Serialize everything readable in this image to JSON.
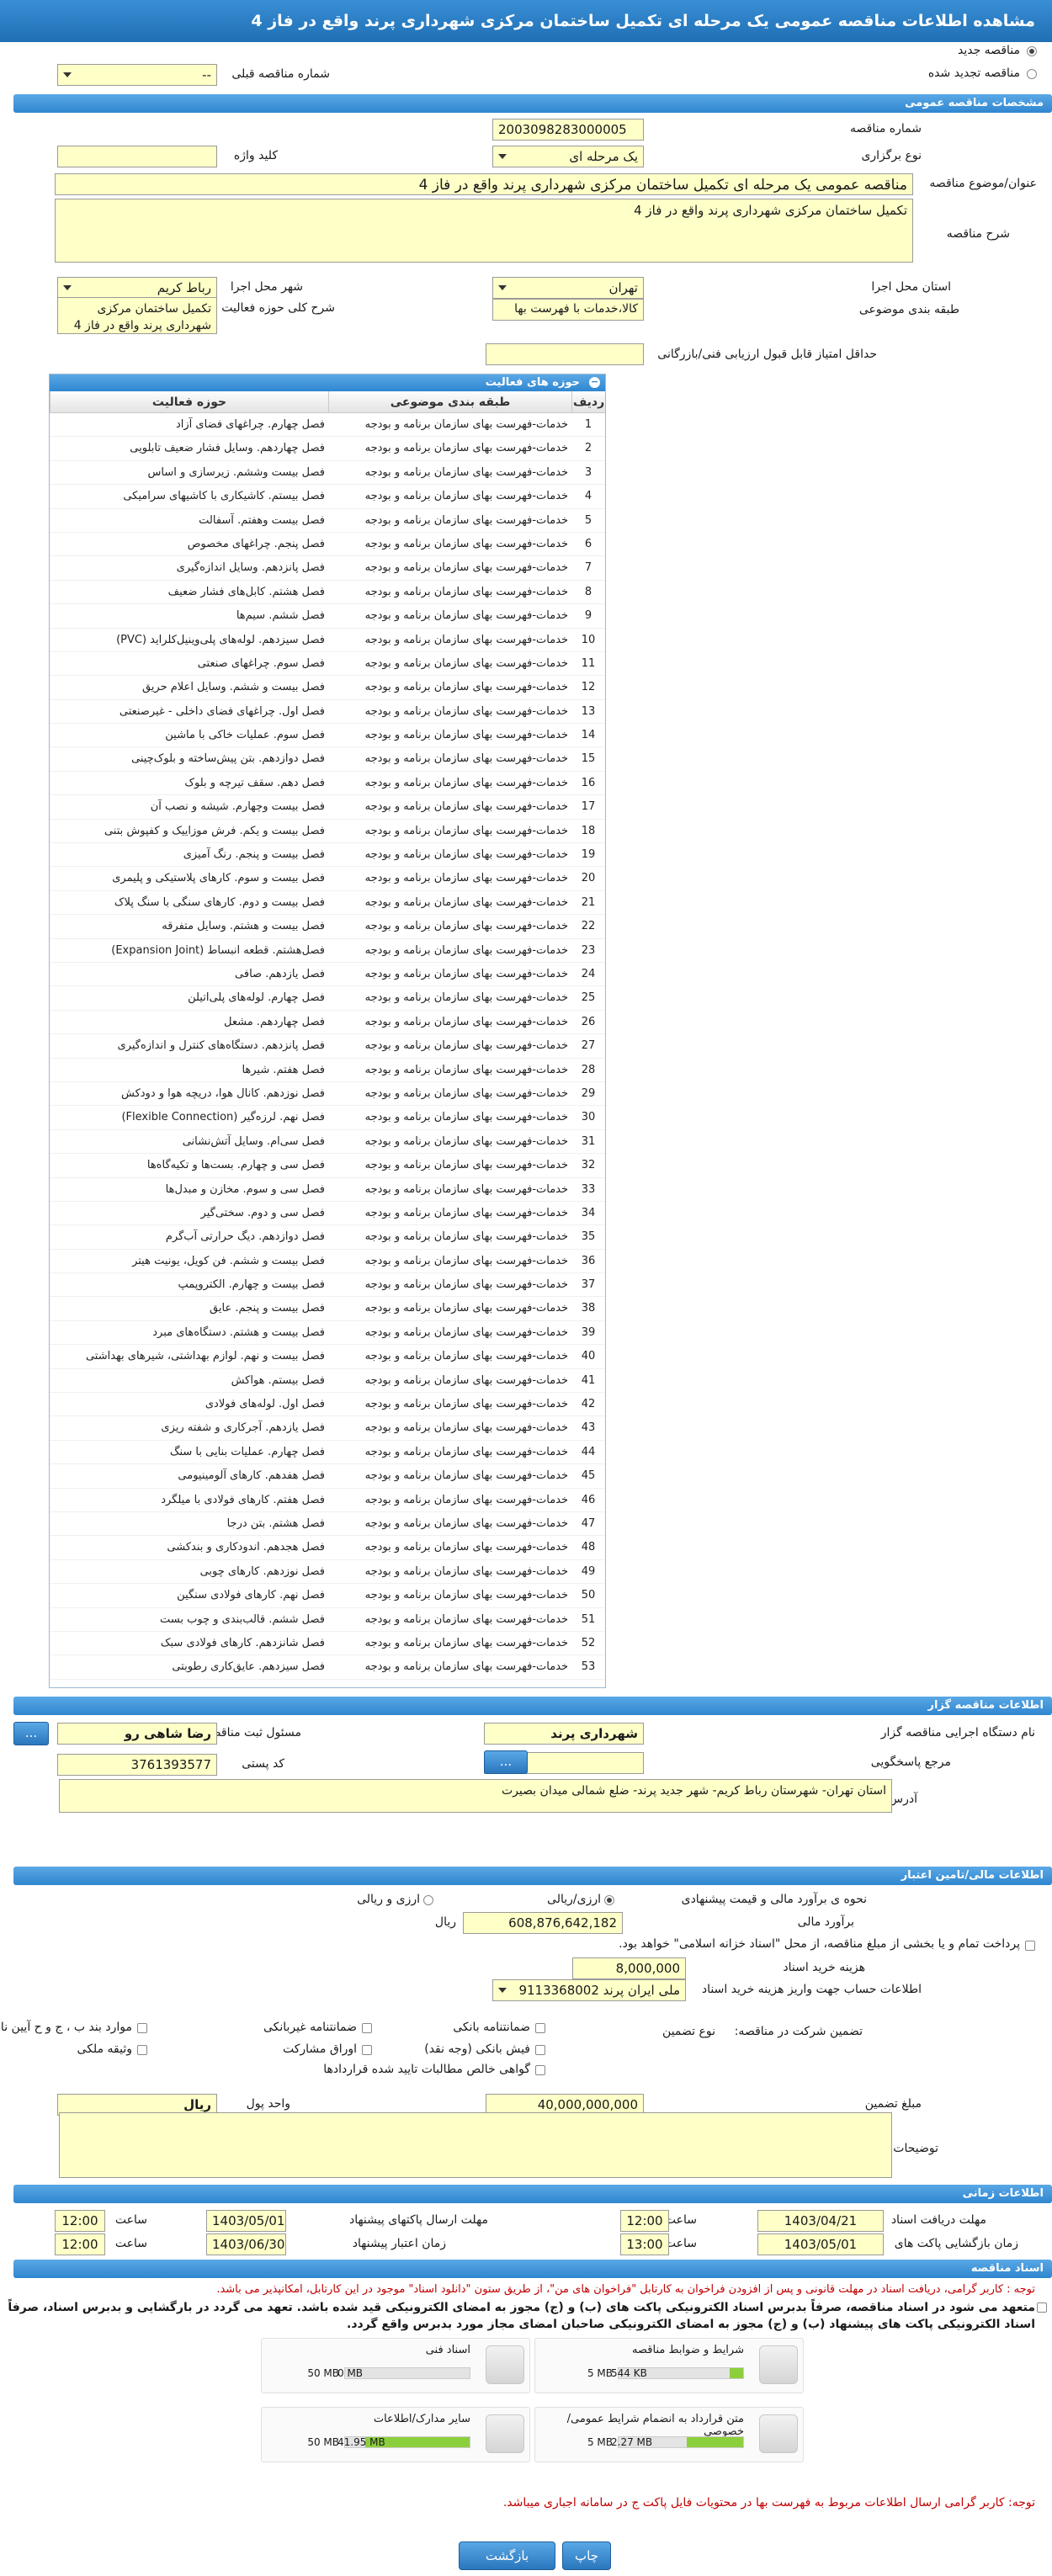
{
  "title": "مشاهده اطلاعات مناقصه عمومی یک مرحله ای تکمیل ساختمان مرکزی شهرداری پرند واقع در فاز 4",
  "top": {
    "radio_new": "مناقصه جدید",
    "radio_renew": "مناقصه تجدید شده",
    "prev_label": "شماره مناقصه قبلی",
    "prev_value": "--"
  },
  "general": {
    "section": "مشخصات مناقصه عمومی",
    "number_label": "شماره مناقصه",
    "number": "2003098283000005",
    "type_label": "نوع برگزاری",
    "type": "یک مرحله ای",
    "keyword_label": "کلید واژه",
    "keyword": "",
    "subject_label": "عنوان/موضوع مناقصه",
    "subject": "مناقصه عمومی یک مرحله ای تکمیل ساختمان مرکزی شهرداری پرند واقع در فاز 4",
    "desc_label": "شرح مناقصه",
    "desc": "تکمیل ساختمان مرکزی شهرداری پرند واقع در فاز 4",
    "province_label": "استان محل اجرا",
    "province": "تهران",
    "city_label": "شهر محل اجرا",
    "city": "رباط کریم",
    "category_label": "طبقه بندی موضوعی",
    "category": "کالا،خدمات با فهرست بها",
    "scope_label": "شرح کلی حوزه فعالیت",
    "scope": "تکمیل ساختمان مرکزی شهرداری پرند واقع در فاز 4",
    "minscore_label": "حداقل امتیاز قابل قبول ارزیابی فنی/بازرگانی",
    "minscore": ""
  },
  "activity": {
    "title": "حوزه های فعالیت",
    "headers": [
      "ردیف",
      "طبقه بندی موضوعی",
      "حوزه فعالیت"
    ],
    "category": "خدمات-فهرست بهای سازمان برنامه و بودجه",
    "rows": [
      "فصل چهارم. چراغهای فضای آزاد",
      "فصل چهاردهم. وسایل فشار ضعیف تابلویی",
      "فصل بیست وششم. زیرسازی و اساس",
      "فصل بیستم. کاشیکاری با کاشیهای سرامیکی",
      "فصل بیست وهفتم. آسفالت",
      "فصل پنجم. چراغهای مخصوص",
      "فصل پانزدهم. وسایل اندازه‌گیری",
      "فصل هشتم. کابل‌های فشار ضعیف",
      "فصل ششم. سیم‌ها",
      "فصل سیزدهم. لوله‌های پلی‌وینیل‌کلراید (PVC)",
      "فصل سوم. چراغهای صنعتی",
      "فصل بیست و ششم. وسایل اعلام حریق",
      "فصل اول. چراغهای فضای داخلی - غیرصنعتی",
      "فصل سوم. عملیات خاکی با ماشین",
      "فصل دوازدهم. بتن پیش‌ساخته و بلوک‌چینی",
      "فصل دهم. سقف تیرچه و بلوک",
      "فصل بیست وچهارم. شیشه و نصب آن",
      "فصل بیست و یکم. فرش موزاییک و کفپوش بتنی",
      "فصل بیست و پنجم. رنگ آمیزی",
      "فصل بیست و سوم. کارهای پلاستیکی و پلیمری",
      "فصل بیست و دوم. کارهای سنگی با سنگ پلاک",
      "فصل بیست و هشتم. وسایل متفرقه",
      "فصل‌هشتم. قطعه انبساط (Expansion Joint)",
      "فصل یازدهم. صافی",
      "فصل چهارم. لوله‌های پلی‌اتیلن",
      "فصل چهاردهم. مشعل",
      "فصل پانزدهم. دستگاه‌های کنترل و اندازه‌گیری",
      "فصل هفتم. شیرها",
      "فصل نوزدهم. کانال هوا، دریچه هوا و دودکش",
      "فصل نهم. لرزه‌گیر (Flexible Connection)",
      "فصل سی‌ام. وسایل آتش‌نشانی",
      "فصل سی و چهارم. بست‌ها و تکیه‌گاه‌ها",
      "فصل سی و سوم. مخازن و مبدل‌ها",
      "فصل سی و دوم. سختی‌گیر",
      "فصل دوازدهم. دیگ حرارتی آب‌گرم",
      "فصل بیست و ششم. فن کویل، یونیت هیتر",
      "فصل بیست و چهارم. الکتروپمپ",
      "فصل بیست و پنجم. عایق",
      "فصل بیست و هشتم. دستگاه‌های مبرد",
      "فصل بیست و نهم. لوازم بهداشتی، شیرهای بهداشتی",
      "فصل بیستم. هواکش",
      "فصل اول. لوله‌های فولادی",
      "فصل یازدهم. آجرکاری و شفته ریزی",
      "فصل چهارم. عملیات بنایی با سنگ",
      "فصل هفدهم. کارهای آلومینیومی",
      "فصل هفتم. کارهای فولادی با میلگرد",
      "فصل هشتم. بتن درجا",
      "فصل هجدهم. اندودکاری و بندکشی",
      "فصل نوزدهم. کارهای چوبی",
      "فصل نهم. کارهای فولادی سنگین",
      "فصل ششم. قالب‌بندی و چوب بست",
      "فصل شانزدهم. کارهای فولادی سبک",
      "فصل سیزدهم. عایق‌کاری رطوبتی"
    ]
  },
  "organizer": {
    "section": "اطلاعات مناقصه گزار",
    "org_label": "نام دستگاه اجرایی مناقصه گزار",
    "org": "شهرداری پرند",
    "resp_label": "مسئول ثبت مناقصه",
    "resp": "رضا شاهی رو",
    "ref_label": "مرجع پاسخگویی",
    "ref": "",
    "postal_label": "کد پستی",
    "postal": "3761393577",
    "addr_label": "آدرس",
    "addr": "استان تهران- شهرستان رباط کریم- شهر جدید پرند- ضلع شمالی میدان بصیرت",
    "btn": "..."
  },
  "finance": {
    "section": "اطلاعات مالی/تامین اعتبار",
    "method_label": "نحوه ی برآورد مالی و قیمت پیشنهادی",
    "opt1": "ارزی/ریالی",
    "opt2": "ارزی و ریالی",
    "estimate_label": "برآورد مالی",
    "estimate": "608,876,642,182",
    "estimate_unit": "ریال",
    "islamic": "پرداخت تمام و یا بخشی از مبلغ مناقصه، از محل \"اسناد خزانه اسلامی\" خواهد بود.",
    "doc_fee_label": "هزینه خرید اسناد",
    "doc_fee": "8,000,000",
    "account_label": "اطلاعات حساب جهت واریز هزینه خرید اسناد",
    "account": "ملی ایران پرند 9113368002",
    "guarantee_label": "تضمین شرکت در مناقصه:",
    "gtype_label": "نوع تضمین",
    "g1": "ضمانتنامه بانکی",
    "g2": "ضمانتنامه غیربانکی",
    "g3": "موارد بند ب ، ج و ح آیین نامه تضامین",
    "g4": "فیش بانکی (وجه نقد)",
    "g5": "اوراق مشارکت",
    "g6": "وثیقه ملکی",
    "g7": "گواهی خالص مطالبات تایید شده قراردادها",
    "amount_label": "مبلغ تضمین",
    "amount": "40,000,000,000",
    "unit_label": "واحد پول",
    "unit": "ریال",
    "notes_label": "توضیحات",
    "notes": ""
  },
  "timing": {
    "section": "اطلاعات زمانی",
    "recv_label": "مهلت دریافت اسناد",
    "recv_date": "1403/04/21",
    "recv_time": "12:00",
    "send_label": "مهلت ارسال پاکتهای پیشنهاد",
    "send_date": "1403/05/01",
    "send_time": "12:00",
    "open_label": "زمان بازگشایی پاکت های",
    "open_date": "1403/05/01",
    "open_time": "13:00",
    "valid_label": "زمان اعتبار پیشنهاد",
    "valid_date": "1403/06/30",
    "valid_time": "12:00",
    "time_label": "ساعت"
  },
  "docs": {
    "section": "اسناد مناقصه",
    "notice1": "توجه : کاربر گرامی، دریافت اسناد در مهلت قانونی و پس از افزودن فراخوان به کارتابل \"فراخوان های من\"، از طریق ستون \"دانلود اسناد\" موجود در این کارتابل، امکانپذیر می باشد.",
    "notice2": "متعهد می شود در اسناد مناقصه، صرفاً بدبرس اسناد الکترونیکی پاکت های (ب) و (ج) مجوز به امضای الکترونیکی قید شده باشد. تعهد می گردد در بارگشایی و بدبرس اسناد، صرفاً اسناد الکترونیکی پاکت های پیشنهاد (ب) و (ج) مجوز به امضای الکترونیکی صاحبان امضای مجاز مورد بدبرس واقع گردد.",
    "files": [
      {
        "name": "شرایط و ضوابط مناقصه",
        "used": "544 KB",
        "max": "5 MB",
        "pct": 11
      },
      {
        "name": "اسناد فنی",
        "used": "0 MB",
        "max": "50 MB",
        "pct": 0
      },
      {
        "name": "متن قرارداد به انضمام شرایط عمومی/خصوصی",
        "used": "2.27 MB",
        "max": "5 MB",
        "pct": 45
      },
      {
        "name": "سایر مدارک/اطلاعات",
        "used": "41.95 MB",
        "max": "50 MB",
        "pct": 84
      }
    ],
    "notice3": "توجه: کاربر گرامی ارسال اطلاعات مربوط به فهرست بها در محتویات فایل پاکت ج در سامانه اجباری میباشد."
  },
  "buttons": {
    "back": "بازگشت",
    "print": "چاپ"
  },
  "colors": {
    "header": "#1f6fb5",
    "field": "#ffffc8",
    "notice": "#c00000"
  }
}
